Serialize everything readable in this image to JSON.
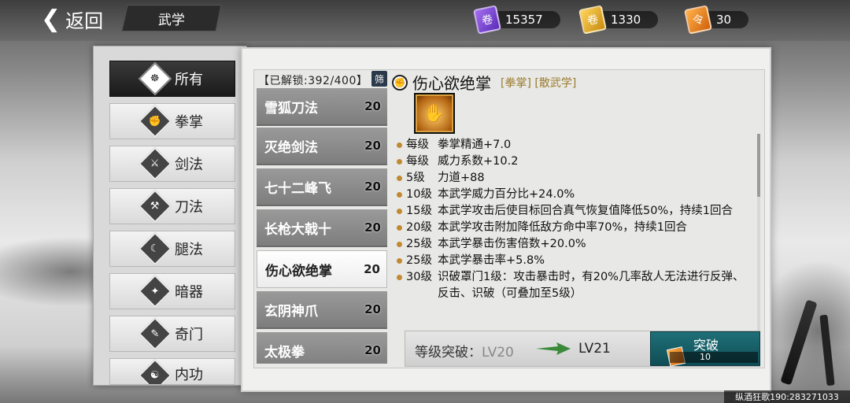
{
  "header": {
    "back_label": "返回",
    "title": "武学"
  },
  "resources": [
    {
      "icon": "purple-scroll-icon",
      "value": "15357",
      "color": "#8a4fe0"
    },
    {
      "icon": "gold-scroll-icon",
      "value": "1330",
      "color": "#e6a820"
    },
    {
      "icon": "orange-token-icon",
      "value": "30",
      "color": "#e88a20"
    }
  ],
  "categories": [
    {
      "label": "所有",
      "icon": "lotus-icon",
      "active": true
    },
    {
      "label": "拳掌",
      "icon": "fist-icon"
    },
    {
      "label": "剑法",
      "icon": "sword-icon"
    },
    {
      "label": "刀法",
      "icon": "blade-icon"
    },
    {
      "label": "腿法",
      "icon": "kick-icon"
    },
    {
      "label": "暗器",
      "icon": "shuriken-icon"
    },
    {
      "label": "奇门",
      "icon": "scroll-icon"
    },
    {
      "label": "内功",
      "icon": "internal-icon"
    }
  ],
  "list": {
    "unlock_text": "【已解锁:392/400】",
    "filter_label": "筛",
    "items": [
      {
        "name": "雪狐刀法",
        "level": "20"
      },
      {
        "name": "灭绝剑法",
        "level": "20"
      },
      {
        "name": "七十二峰飞",
        "level": "20"
      },
      {
        "name": "长枪大戟十",
        "level": "20"
      },
      {
        "name": "伤心欲绝掌",
        "level": "20",
        "selected": true
      },
      {
        "name": "玄阴神爪",
        "level": "20"
      },
      {
        "name": "太极拳",
        "level": "20"
      }
    ]
  },
  "detail": {
    "name": "伤心欲绝掌",
    "tags": "[拳掌] [散武学]",
    "effects": [
      {
        "lv": "每级",
        "text": "拳掌精通+7.0"
      },
      {
        "lv": "每级",
        "text": "威力系数+10.2"
      },
      {
        "lv": "5级",
        "text": "力道+88"
      },
      {
        "lv": "10级",
        "text": "本武学威力百分比+24.0%"
      },
      {
        "lv": "15级",
        "text": "本武学攻击后使目标回合真气恢复值降低50%，持续1回合"
      },
      {
        "lv": "20级",
        "text": "本武学攻击附加降低敌方命中率70%，持续1回合"
      },
      {
        "lv": "25级",
        "text": "本武学暴击伤害倍数+20.0%"
      },
      {
        "lv": "25级",
        "text": "本武学暴击率+5.8%"
      },
      {
        "lv": "30级",
        "text": "识破罩门1级：攻击暴击时，有20%几率敌人无法进行反弹、反击、识破（可叠加至5级）"
      }
    ]
  },
  "breakthrough": {
    "label": "等级突破：",
    "from": "LV20",
    "to": "LV21",
    "button_label": "突破",
    "cost": "10"
  },
  "footer": {
    "text": "纵酒狂歌190:283271033"
  }
}
